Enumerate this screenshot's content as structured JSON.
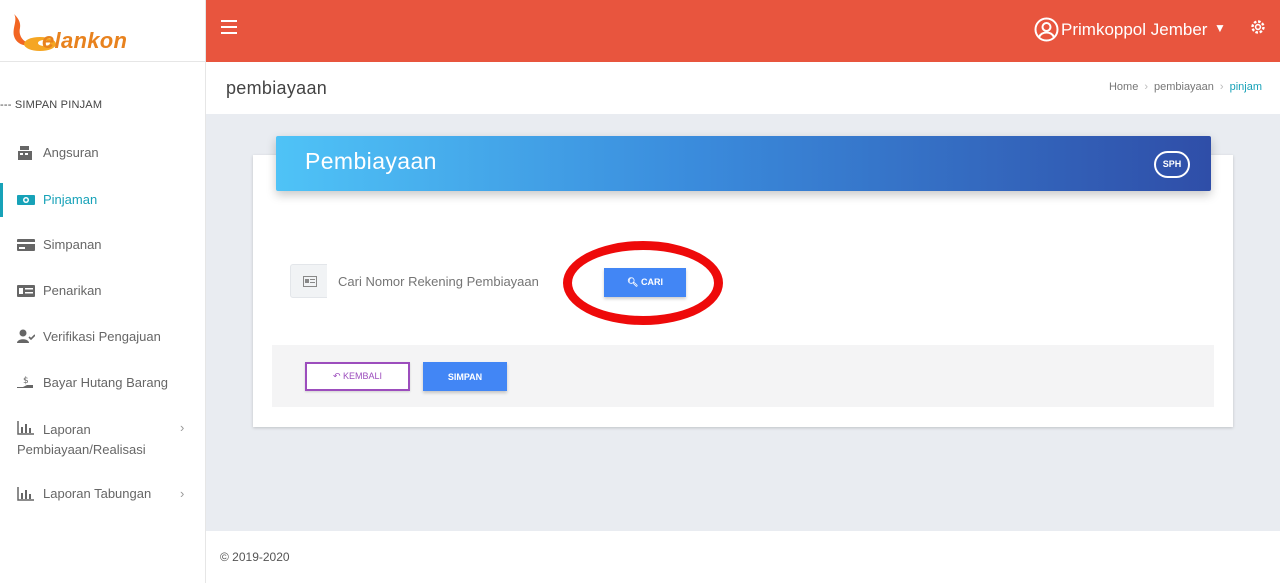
{
  "brand": {
    "name": "elankon",
    "colors": {
      "primary": "#e8821e",
      "flame": "#f5a623"
    }
  },
  "sidebar": {
    "section_label": "--- SIMPAN PINJAM",
    "items": [
      {
        "label": "Angsuran",
        "icon": "cash-register-icon",
        "active": false
      },
      {
        "label": "Pinjaman",
        "icon": "money-bill-icon",
        "active": true
      },
      {
        "label": "Simpanan",
        "icon": "credit-card-icon",
        "active": false
      },
      {
        "label": "Penarikan",
        "icon": "money-check-icon",
        "active": false
      },
      {
        "label": "Verifikasi Pengajuan",
        "icon": "user-check-icon",
        "active": false
      },
      {
        "label": "Bayar Hutang Barang",
        "icon": "hand-holding-dollar-icon",
        "active": false
      },
      {
        "label": "Laporan Pembiayaan/Realisasi",
        "icon": "chart-bar-icon",
        "has_submenu": true
      },
      {
        "label": "Laporan Tabungan",
        "icon": "chart-bar-icon",
        "has_submenu": true
      }
    ]
  },
  "topbar": {
    "user_name": "Primkoppol Jember",
    "color": "#e8553e"
  },
  "header": {
    "page_title": "pembiayaan",
    "breadcrumb": [
      "Home",
      "pembiayaan",
      "pinjam"
    ]
  },
  "card": {
    "title": "Pembiayaan",
    "badge": "SPH",
    "search": {
      "placeholder": "Cari Nomor Rekening Pembiayaan",
      "button_label": "CARI"
    },
    "buttons": {
      "back_label": "KEMBALI",
      "save_label": "SIMPAN"
    }
  },
  "footer": {
    "copyright": "© 2019-2020"
  }
}
